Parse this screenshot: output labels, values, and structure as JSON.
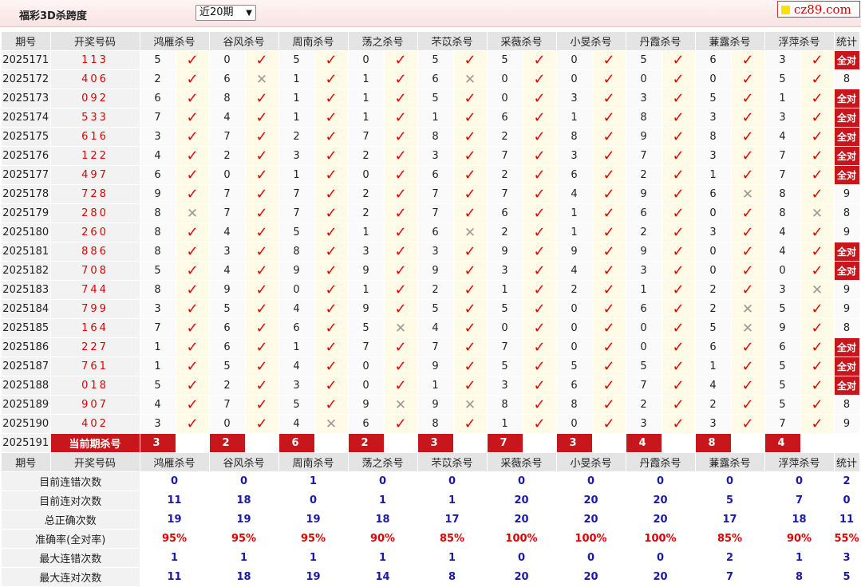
{
  "header": {
    "title": "福彩3D杀跨度",
    "period_selected": "近20期",
    "logo_text": "cz89.com"
  },
  "columns": {
    "issue": "期号",
    "draw": "开奖号码",
    "experts": [
      "鸿雁杀号",
      "谷风杀号",
      "周南杀号",
      "荡之杀号",
      "芣苡杀号",
      "采薇杀号",
      "小旻杀号",
      "丹霞杀号",
      "蒹露杀号",
      "浮萍杀号"
    ],
    "stat": "统计"
  },
  "rows": [
    {
      "issue": "2025171",
      "draw": "113",
      "kills": [
        [
          5,
          1
        ],
        [
          0,
          1
        ],
        [
          5,
          1
        ],
        [
          0,
          1
        ],
        [
          5,
          1
        ],
        [
          5,
          1
        ],
        [
          0,
          1
        ],
        [
          5,
          1
        ],
        [
          6,
          1
        ],
        [
          3,
          1
        ]
      ],
      "stat": "全对"
    },
    {
      "issue": "2025172",
      "draw": "406",
      "kills": [
        [
          2,
          1
        ],
        [
          6,
          0
        ],
        [
          1,
          1
        ],
        [
          1,
          1
        ],
        [
          6,
          0
        ],
        [
          0,
          1
        ],
        [
          0,
          1
        ],
        [
          0,
          1
        ],
        [
          0,
          1
        ],
        [
          5,
          1
        ]
      ],
      "stat": "8"
    },
    {
      "issue": "2025173",
      "draw": "092",
      "kills": [
        [
          6,
          1
        ],
        [
          8,
          1
        ],
        [
          1,
          1
        ],
        [
          1,
          1
        ],
        [
          5,
          1
        ],
        [
          0,
          1
        ],
        [
          3,
          1
        ],
        [
          3,
          1
        ],
        [
          5,
          1
        ],
        [
          1,
          1
        ]
      ],
      "stat": "全对"
    },
    {
      "issue": "2025174",
      "draw": "533",
      "kills": [
        [
          7,
          1
        ],
        [
          4,
          1
        ],
        [
          1,
          1
        ],
        [
          1,
          1
        ],
        [
          1,
          1
        ],
        [
          6,
          1
        ],
        [
          1,
          1
        ],
        [
          8,
          1
        ],
        [
          3,
          1
        ],
        [
          3,
          1
        ]
      ],
      "stat": "全对"
    },
    {
      "issue": "2025175",
      "draw": "616",
      "kills": [
        [
          3,
          1
        ],
        [
          7,
          1
        ],
        [
          2,
          1
        ],
        [
          7,
          1
        ],
        [
          8,
          1
        ],
        [
          2,
          1
        ],
        [
          8,
          1
        ],
        [
          9,
          1
        ],
        [
          8,
          1
        ],
        [
          4,
          1
        ]
      ],
      "stat": "全对"
    },
    {
      "issue": "2025176",
      "draw": "122",
      "kills": [
        [
          4,
          1
        ],
        [
          2,
          1
        ],
        [
          3,
          1
        ],
        [
          2,
          1
        ],
        [
          3,
          1
        ],
        [
          7,
          1
        ],
        [
          3,
          1
        ],
        [
          7,
          1
        ],
        [
          3,
          1
        ],
        [
          7,
          1
        ]
      ],
      "stat": "全对"
    },
    {
      "issue": "2025177",
      "draw": "497",
      "kills": [
        [
          6,
          1
        ],
        [
          0,
          1
        ],
        [
          1,
          1
        ],
        [
          0,
          1
        ],
        [
          6,
          1
        ],
        [
          2,
          1
        ],
        [
          6,
          1
        ],
        [
          2,
          1
        ],
        [
          1,
          1
        ],
        [
          7,
          1
        ]
      ],
      "stat": "全对"
    },
    {
      "issue": "2025178",
      "draw": "728",
      "kills": [
        [
          9,
          1
        ],
        [
          7,
          1
        ],
        [
          7,
          1
        ],
        [
          2,
          1
        ],
        [
          7,
          1
        ],
        [
          7,
          1
        ],
        [
          4,
          1
        ],
        [
          9,
          1
        ],
        [
          6,
          0
        ],
        [
          8,
          1
        ]
      ],
      "stat": "9"
    },
    {
      "issue": "2025179",
      "draw": "280",
      "kills": [
        [
          8,
          0
        ],
        [
          7,
          1
        ],
        [
          7,
          1
        ],
        [
          2,
          1
        ],
        [
          7,
          1
        ],
        [
          6,
          1
        ],
        [
          1,
          1
        ],
        [
          6,
          1
        ],
        [
          0,
          1
        ],
        [
          8,
          0
        ]
      ],
      "stat": "8"
    },
    {
      "issue": "2025180",
      "draw": "260",
      "kills": [
        [
          8,
          1
        ],
        [
          4,
          1
        ],
        [
          5,
          1
        ],
        [
          1,
          1
        ],
        [
          6,
          0
        ],
        [
          2,
          1
        ],
        [
          1,
          1
        ],
        [
          2,
          1
        ],
        [
          3,
          1
        ],
        [
          4,
          1
        ]
      ],
      "stat": "9"
    },
    {
      "issue": "2025181",
      "draw": "886",
      "kills": [
        [
          8,
          1
        ],
        [
          3,
          1
        ],
        [
          8,
          1
        ],
        [
          3,
          1
        ],
        [
          3,
          1
        ],
        [
          9,
          1
        ],
        [
          9,
          1
        ],
        [
          9,
          1
        ],
        [
          0,
          1
        ],
        [
          4,
          1
        ]
      ],
      "stat": "全对"
    },
    {
      "issue": "2025182",
      "draw": "708",
      "kills": [
        [
          5,
          1
        ],
        [
          4,
          1
        ],
        [
          9,
          1
        ],
        [
          9,
          1
        ],
        [
          9,
          1
        ],
        [
          3,
          1
        ],
        [
          4,
          1
        ],
        [
          3,
          1
        ],
        [
          0,
          1
        ],
        [
          0,
          1
        ]
      ],
      "stat": "全对"
    },
    {
      "issue": "2025183",
      "draw": "744",
      "kills": [
        [
          8,
          1
        ],
        [
          9,
          1
        ],
        [
          0,
          1
        ],
        [
          1,
          1
        ],
        [
          2,
          1
        ],
        [
          1,
          1
        ],
        [
          2,
          1
        ],
        [
          1,
          1
        ],
        [
          2,
          1
        ],
        [
          3,
          0
        ]
      ],
      "stat": "9"
    },
    {
      "issue": "2025184",
      "draw": "799",
      "kills": [
        [
          3,
          1
        ],
        [
          5,
          1
        ],
        [
          4,
          1
        ],
        [
          9,
          1
        ],
        [
          5,
          1
        ],
        [
          5,
          1
        ],
        [
          0,
          1
        ],
        [
          6,
          1
        ],
        [
          2,
          0
        ],
        [
          5,
          1
        ]
      ],
      "stat": "9"
    },
    {
      "issue": "2025185",
      "draw": "164",
      "kills": [
        [
          7,
          1
        ],
        [
          6,
          1
        ],
        [
          6,
          1
        ],
        [
          5,
          0
        ],
        [
          4,
          1
        ],
        [
          0,
          1
        ],
        [
          0,
          1
        ],
        [
          0,
          1
        ],
        [
          5,
          0
        ],
        [
          9,
          1
        ]
      ],
      "stat": "8"
    },
    {
      "issue": "2025186",
      "draw": "227",
      "kills": [
        [
          1,
          1
        ],
        [
          6,
          1
        ],
        [
          1,
          1
        ],
        [
          7,
          1
        ],
        [
          7,
          1
        ],
        [
          7,
          1
        ],
        [
          0,
          1
        ],
        [
          0,
          1
        ],
        [
          6,
          1
        ],
        [
          6,
          1
        ]
      ],
      "stat": "全对"
    },
    {
      "issue": "2025187",
      "draw": "761",
      "kills": [
        [
          1,
          1
        ],
        [
          5,
          1
        ],
        [
          4,
          1
        ],
        [
          0,
          1
        ],
        [
          9,
          1
        ],
        [
          5,
          1
        ],
        [
          5,
          1
        ],
        [
          5,
          1
        ],
        [
          1,
          1
        ],
        [
          5,
          1
        ]
      ],
      "stat": "全对"
    },
    {
      "issue": "2025188",
      "draw": "018",
      "kills": [
        [
          5,
          1
        ],
        [
          2,
          1
        ],
        [
          3,
          1
        ],
        [
          0,
          1
        ],
        [
          1,
          1
        ],
        [
          3,
          1
        ],
        [
          6,
          1
        ],
        [
          7,
          1
        ],
        [
          4,
          1
        ],
        [
          5,
          1
        ]
      ],
      "stat": "全对"
    },
    {
      "issue": "2025189",
      "draw": "907",
      "kills": [
        [
          4,
          1
        ],
        [
          7,
          1
        ],
        [
          5,
          1
        ],
        [
          9,
          0
        ],
        [
          9,
          0
        ],
        [
          8,
          1
        ],
        [
          8,
          1
        ],
        [
          2,
          1
        ],
        [
          2,
          1
        ],
        [
          5,
          1
        ]
      ],
      "stat": "8"
    },
    {
      "issue": "2025190",
      "draw": "402",
      "kills": [
        [
          3,
          1
        ],
        [
          0,
          1
        ],
        [
          4,
          0
        ],
        [
          6,
          1
        ],
        [
          8,
          1
        ],
        [
          1,
          1
        ],
        [
          0,
          1
        ],
        [
          3,
          1
        ],
        [
          3,
          1
        ],
        [
          7,
          1
        ]
      ],
      "stat": "9"
    }
  ],
  "current": {
    "issue": "2025191",
    "label": "当前期杀号",
    "kills": [
      "3",
      "2",
      "6",
      "2",
      "3",
      "7",
      "3",
      "4",
      "8",
      "4"
    ]
  },
  "summary": [
    {
      "label": "目前连错次数",
      "values": [
        "0",
        "0",
        "1",
        "0",
        "0",
        "0",
        "0",
        "0",
        "0",
        "0",
        "2"
      ]
    },
    {
      "label": "目前连对次数",
      "values": [
        "11",
        "18",
        "0",
        "1",
        "1",
        "20",
        "20",
        "20",
        "5",
        "7",
        "0"
      ]
    },
    {
      "label": "总正确次数",
      "values": [
        "19",
        "19",
        "19",
        "18",
        "17",
        "20",
        "20",
        "20",
        "17",
        "18",
        "11"
      ]
    },
    {
      "label": "准确率(全对率)",
      "values": [
        "95%",
        "95%",
        "95%",
        "90%",
        "85%",
        "100%",
        "100%",
        "100%",
        "85%",
        "90%",
        "55%"
      ],
      "pct": true
    },
    {
      "label": "最大连错次数",
      "values": [
        "1",
        "1",
        "1",
        "1",
        "1",
        "0",
        "0",
        "0",
        "2",
        "1",
        "3"
      ]
    },
    {
      "label": "最大连对次数",
      "values": [
        "11",
        "18",
        "19",
        "14",
        "8",
        "20",
        "20",
        "20",
        "7",
        "8",
        "5"
      ]
    }
  ],
  "icons": {
    "hit": "check-icon",
    "miss": "cross-icon"
  },
  "colors": {
    "accent": "#c8161d",
    "draw_red": "#e00000",
    "summary_blue": "#1a1aa8",
    "mark_bg": "#fffbe6"
  }
}
